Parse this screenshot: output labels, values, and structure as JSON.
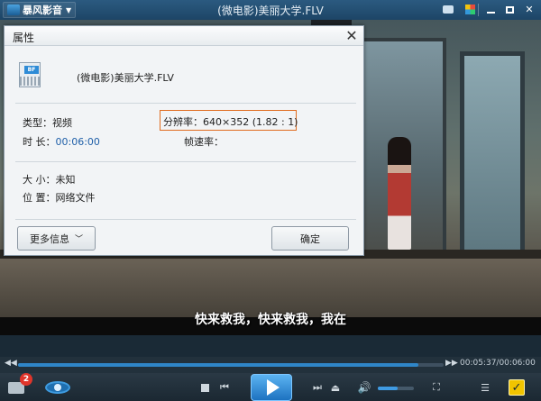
{
  "app": {
    "logo_text": "暴风影音",
    "window_title": "(微电影)美丽大学.FLV"
  },
  "video": {
    "subtitle": "快来救我，快来救我，我在"
  },
  "playback": {
    "time_text": "00:05:37/00:06:00",
    "progress_fraction": 0.94,
    "volume_fraction": 0.55,
    "playlist_badge": "2"
  },
  "dialog": {
    "title": "属性",
    "close_glyph": "✕",
    "file_name": "(微电影)美丽大学.FLV",
    "file_icon_label": "BF",
    "type_label": "类型：",
    "type_value": "视频",
    "resolution_label": "分辨率：",
    "resolution_value": "640×352 (1.82 : 1)",
    "duration_label": "时 长：",
    "duration_value": "00:06:00",
    "framerate_label": "帧速率：",
    "framerate_value": "",
    "size_label": "大 小：",
    "size_value": "未知",
    "location_label": "位 置：",
    "location_value": "网络文件",
    "more_info_button": "更多信息",
    "ok_button": "确定"
  },
  "icons": {
    "title_bar": [
      "chat-icon",
      "skin-icon",
      "minimize-icon",
      "maximize-icon",
      "close-icon"
    ],
    "controls": [
      "playlist-icon",
      "eye-icon",
      "stop-icon",
      "previous-icon",
      "play-icon",
      "next-icon",
      "eject-icon",
      "volume-icon",
      "fullscreen-icon",
      "menu-icon",
      "check-icon"
    ]
  },
  "colors": {
    "accent": "#2f86c8",
    "highlight_border": "#e06c1f",
    "title_bar": "#1d4566"
  }
}
